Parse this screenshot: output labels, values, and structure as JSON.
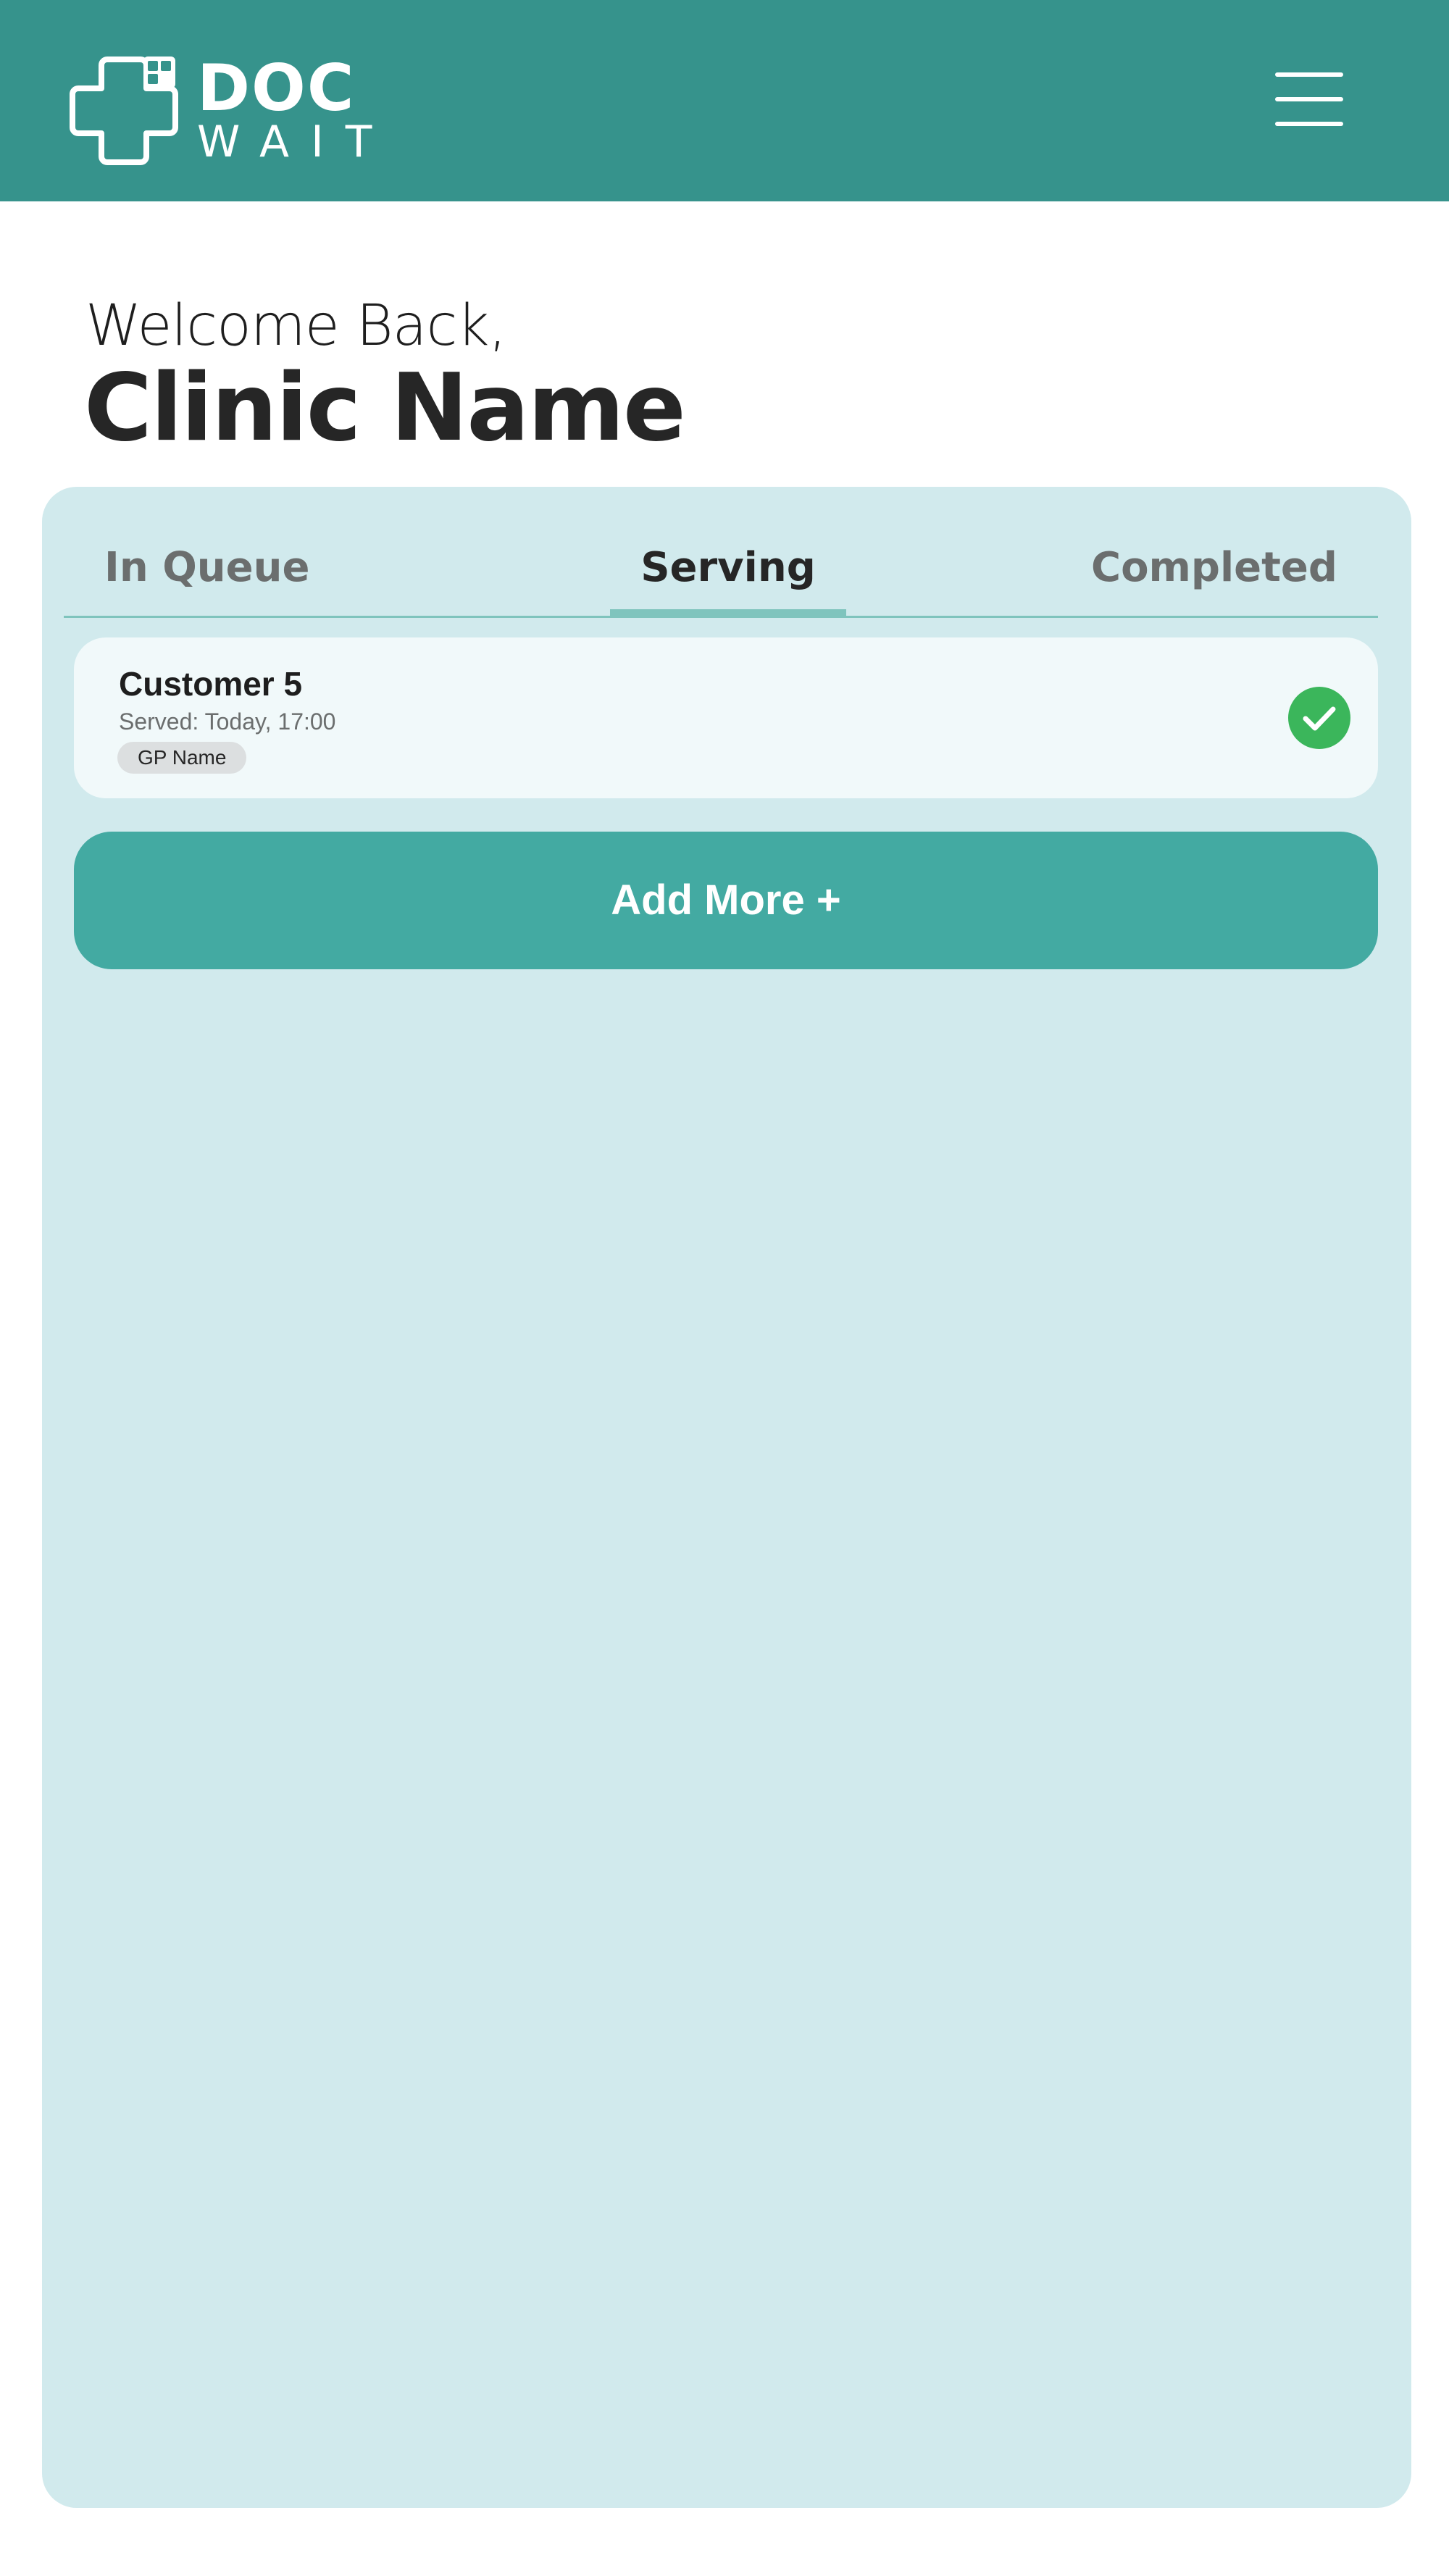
{
  "app": {
    "logo_top": "DOC",
    "logo_bottom": "WAIT"
  },
  "colors": {
    "header": "#36938c",
    "panel": "#d1eaed",
    "card": "#f1f9fa",
    "accent": "#43aaa2",
    "tab_underline": "#7fc4bd",
    "success": "#3bb65b"
  },
  "welcome": {
    "greeting": "Welcome Back,",
    "clinic_name": "Clinic Name"
  },
  "tabs": [
    {
      "label": "In Queue",
      "active": false
    },
    {
      "label": "Serving",
      "active": true
    },
    {
      "label": "Completed",
      "active": false
    }
  ],
  "queue": [
    {
      "name": "Customer 5",
      "served": "Served: Today, 17:00",
      "gp": "GP Name",
      "status_icon": "check-circle-icon"
    }
  ],
  "actions": {
    "add_more_label": "Add More +"
  },
  "icons": {
    "logo": "medical-cross-logo-icon",
    "menu": "hamburger-menu-icon"
  }
}
